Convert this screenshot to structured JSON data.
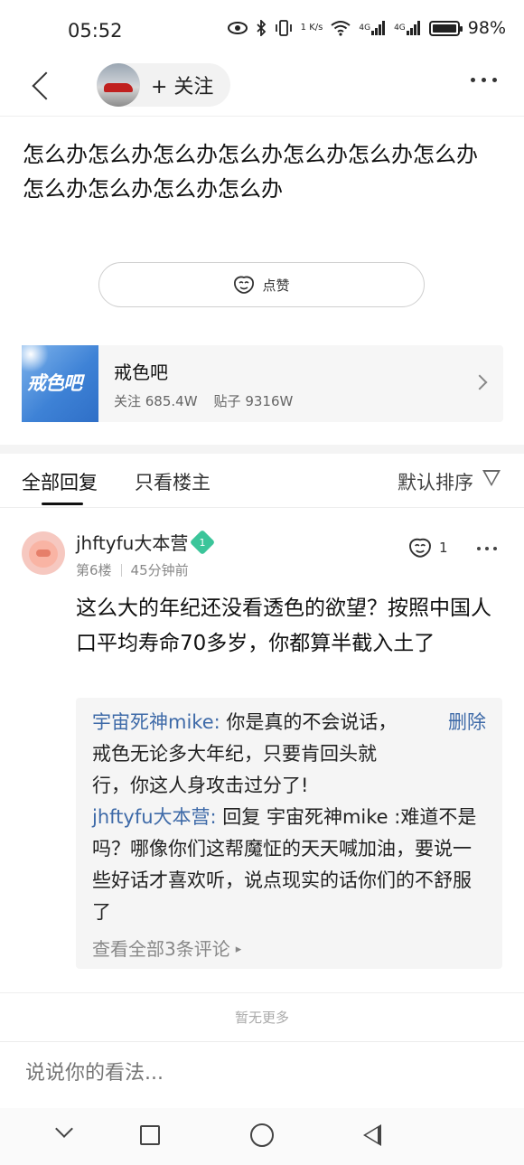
{
  "status_bar": {
    "time": "05:52",
    "network_speed": "1 K/s",
    "signal_1": "4G",
    "signal_2": "4G",
    "battery_percent": "98%",
    "icons": [
      "eye-icon",
      "bluetooth-icon",
      "vibrate-icon",
      "wifi-icon",
      "signal-icon",
      "battery-icon"
    ]
  },
  "header": {
    "follow_label": "+ 关注",
    "more_icon": "more-icon"
  },
  "post": {
    "text": "怎么办怎么办怎么办怎么办怎么办怎么办怎么办\n怎么办怎么办怎么办怎么办",
    "like_label": "点赞"
  },
  "forum": {
    "logo_text": "戒色吧",
    "name": "戒色吧",
    "followers": "关注 685.4W",
    "posts": "贴子 9316W"
  },
  "tabs": {
    "all_replies": "全部回复",
    "op_only": "只看楼主",
    "sort": "默认排序"
  },
  "reply": {
    "username": "jhftyfu大本营",
    "level": "1",
    "floor": "第6楼",
    "time": "45分钟前",
    "like_count": "1",
    "content": "这么大的年纪还没看透色的欲望？按照中国人口平均寿命70多岁，你都算半截入土了",
    "sub_comments": [
      {
        "name": "宇宙死神mike:",
        "text": "你是真的不会说话，戒色无论多大年纪，只要肯回头就行，你这人身攻击过分了!",
        "action": "删除"
      },
      {
        "name": "jhftyfu大本营:",
        "text": "回复 宇宙死神mike :难道不是吗？哪像你们这帮魔怔的天天喊加油，要说一些好话才喜欢听，说点现实的话你们的不舒服了"
      }
    ],
    "view_all": "查看全部3条评论"
  },
  "footer": {
    "no_more": "暂无更多",
    "comment_placeholder": "说说你的看法..."
  },
  "colors": {
    "link_blue": "#3e6aa8",
    "level_badge_green": "#3bc59a",
    "forum_logo_blue": "#3e82d6"
  }
}
